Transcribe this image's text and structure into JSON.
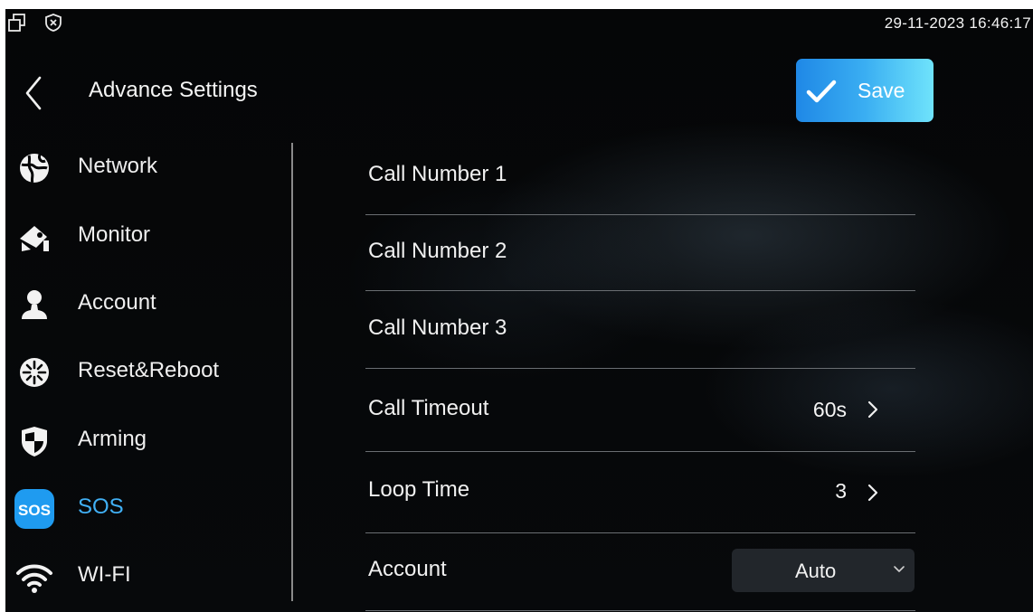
{
  "status_bar": {
    "datetime": "29-11-2023 16:46:17",
    "icons": [
      "window-restore-icon",
      "shield-x-icon"
    ]
  },
  "header": {
    "title": "Advance Settings",
    "back_icon": "chevron-left-icon",
    "save_label": "Save",
    "save_icon": "check-icon",
    "save_gradient": [
      "#1f88e6",
      "#6fe3fb"
    ]
  },
  "sidebar": {
    "items": [
      {
        "label": "Network",
        "icon": "globe-icon",
        "active": false
      },
      {
        "label": "Monitor",
        "icon": "camera-icon",
        "active": false
      },
      {
        "label": "Account",
        "icon": "user-icon",
        "active": false
      },
      {
        "label": "Reset&Reboot",
        "icon": "reset-icon",
        "active": false
      },
      {
        "label": "Arming",
        "icon": "shield-icon",
        "active": false
      },
      {
        "label": "SOS",
        "icon": "sos-icon",
        "icon_text": "SOS",
        "active": true
      },
      {
        "label": "WI-FI",
        "icon": "wifi-icon",
        "active": false
      }
    ],
    "active_color": "#41b0f5"
  },
  "settings": {
    "call_number_1": {
      "label": "Call Number 1"
    },
    "call_number_2": {
      "label": "Call Number 2"
    },
    "call_number_3": {
      "label": "Call Number 3"
    },
    "call_timeout": {
      "label": "Call Timeout",
      "value": "60s"
    },
    "loop_time": {
      "label": "Loop Time",
      "value": "3"
    },
    "account": {
      "label": "Account",
      "value": "Auto"
    }
  }
}
